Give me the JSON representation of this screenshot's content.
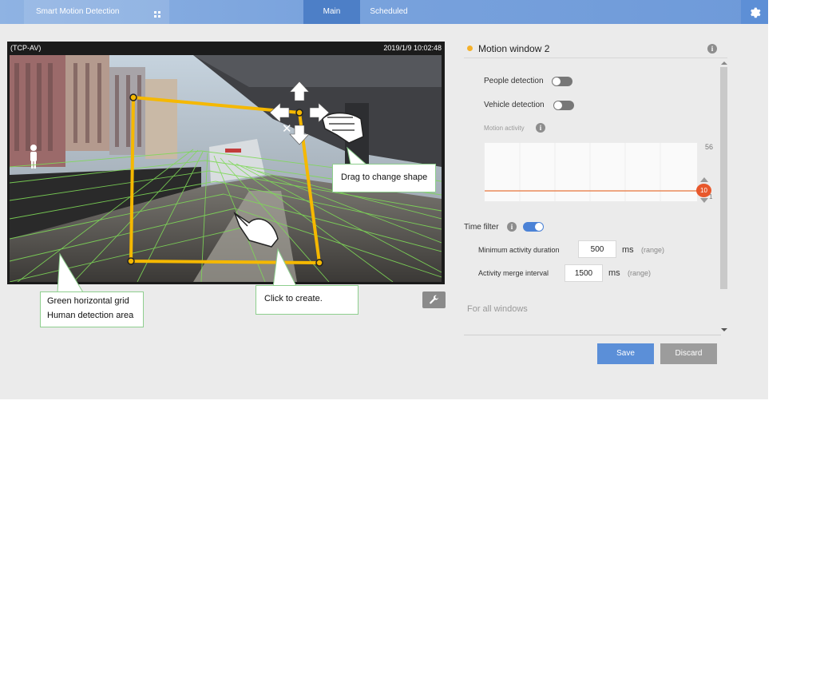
{
  "header": {
    "app_title": "Smart Motion Detection",
    "tabs": [
      {
        "label": "Main",
        "active": true
      },
      {
        "label": "Scheduled",
        "active": false
      }
    ],
    "accent_color": "#4d7fc7"
  },
  "video": {
    "stream_label": "(TCP-AV)",
    "timestamp": "2019/1/9 10:02:48",
    "window_color": "#f5b800",
    "grid_color": "#7ed957"
  },
  "callouts": {
    "drag": "Drag to change shape",
    "click": "Click to create.",
    "grid_line1": "Green horizontal grid",
    "grid_line2": "Human detection area"
  },
  "panel": {
    "window_title": "Motion window 2",
    "people_detection": {
      "label": "People detection",
      "enabled": false
    },
    "vehicle_detection": {
      "label": "Vehicle detection",
      "enabled": false
    },
    "motion_activity_label": "Motion activity",
    "chart": {
      "max_label": "56",
      "min_label": "1",
      "threshold": "10"
    },
    "time_filter": {
      "label": "Time filter",
      "enabled": true
    },
    "min_duration": {
      "label": "Minimum activity duration",
      "value": "500",
      "unit": "ms",
      "range": "(range)"
    },
    "merge_interval": {
      "label": "Activity merge interval",
      "value": "1500",
      "unit": "ms",
      "range": "(range)"
    },
    "for_all_windows": "For all windows"
  },
  "buttons": {
    "save": "Save",
    "discard": "Discard"
  }
}
